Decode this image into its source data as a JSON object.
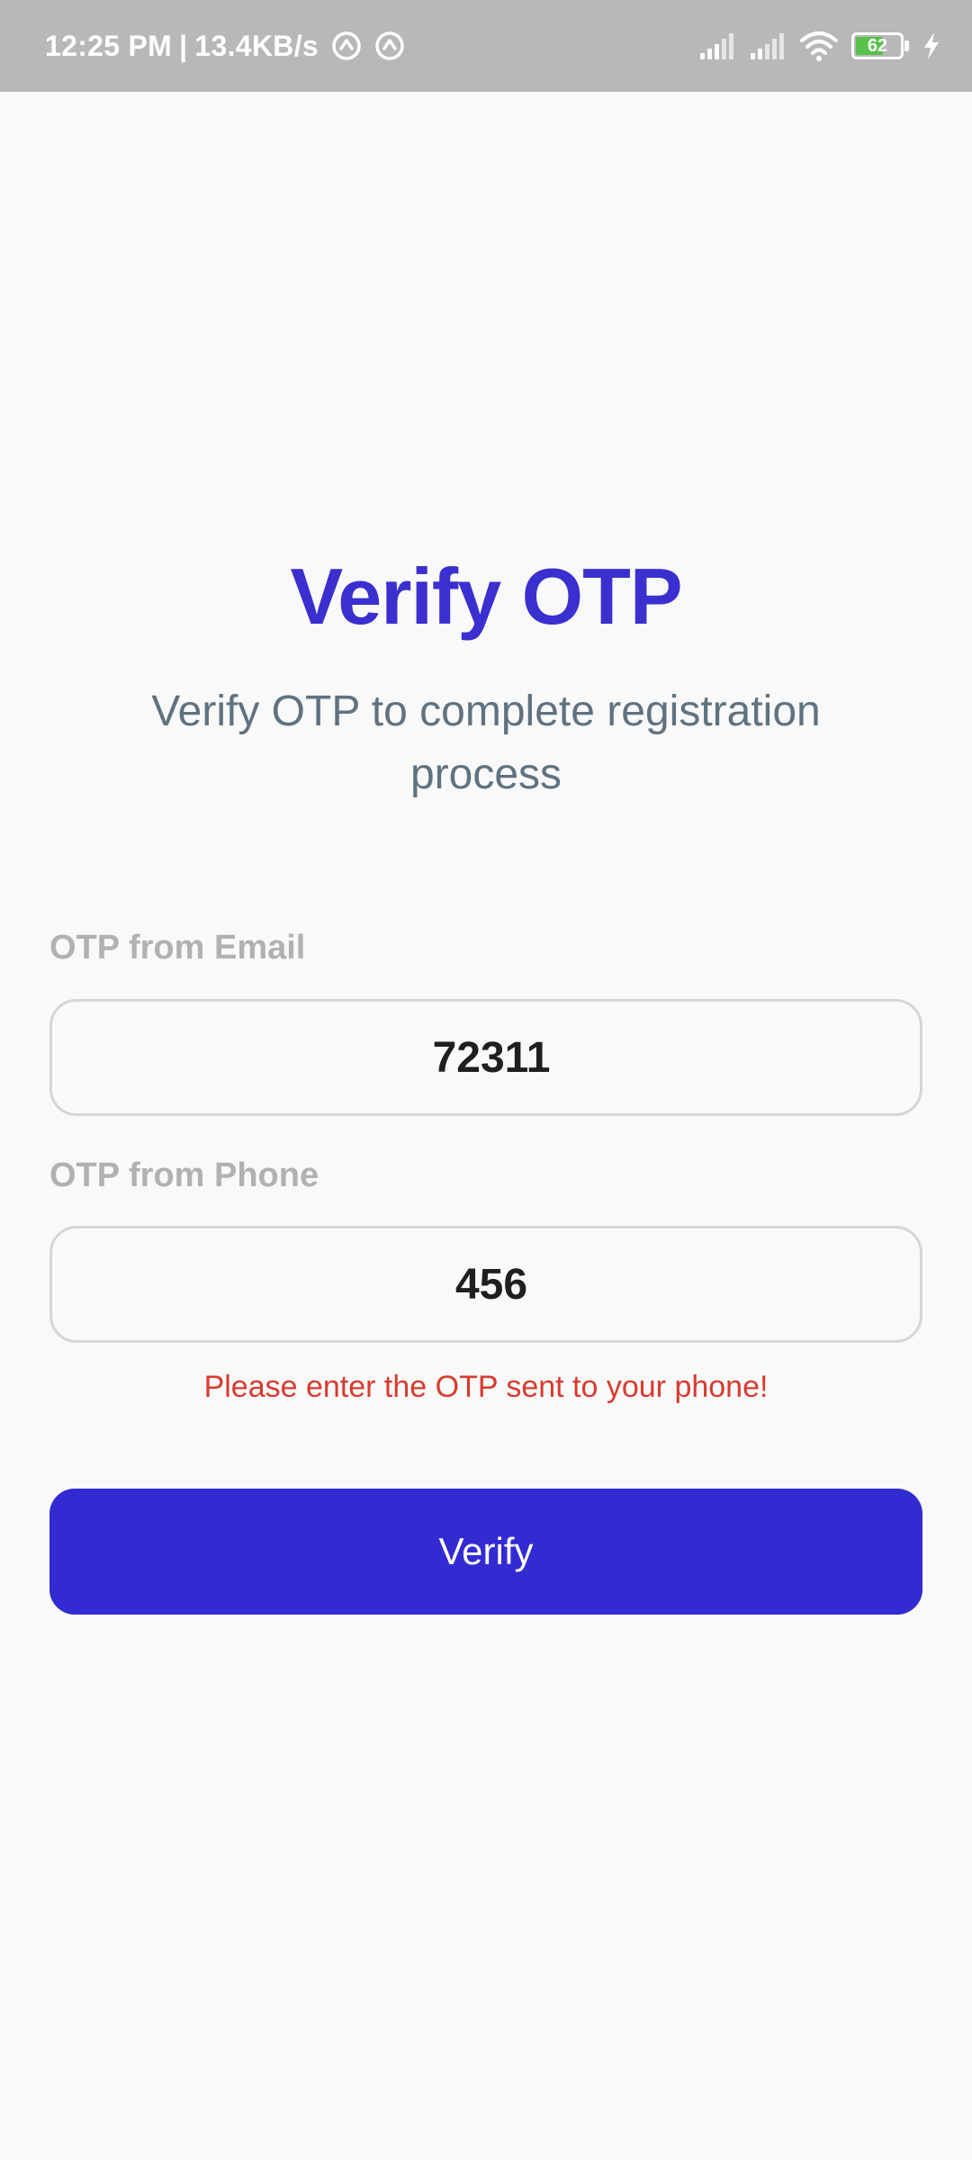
{
  "status_bar": {
    "time": "12:25 PM",
    "separator": "|",
    "network_speed": "13.4KB/s",
    "app_icons": [
      "sync-icon",
      "sync-icon"
    ],
    "right_icons": [
      "signal-icon",
      "signal-icon",
      "wifi-icon",
      "battery-icon",
      "charging-bolt-icon"
    ],
    "battery_level": "62",
    "battery_color": "#58c24a"
  },
  "header": {
    "title": "Verify OTP",
    "subtitle": "Verify OTP to complete registration process"
  },
  "form": {
    "email_otp_label": "OTP from Email",
    "email_otp_value": "72311",
    "phone_otp_label": "OTP from Phone",
    "phone_otp_value": "456",
    "error_message": "Please enter the OTP sent to your phone!",
    "verify_label": "Verify"
  },
  "colors": {
    "accent": "#332bd2",
    "title": "#3a2fcf",
    "error": "#d93a2f",
    "subtitle": "#5f7280",
    "status_bar": "#b8b8b8",
    "background": "#f9f9f9"
  }
}
